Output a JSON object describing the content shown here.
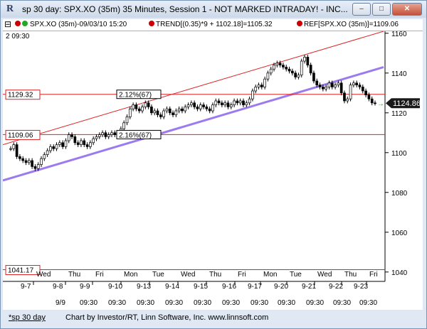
{
  "window": {
    "title": "sp 30 day: SPX.XO (35m) 35 Minutes, Session 1 - NOT MARKED INTRADAY! - INC...",
    "app_icon": "R",
    "minimize_label": "–",
    "maximize_label": "□",
    "close_label": "✕"
  },
  "legend": {
    "symbol": "SPX.XO (35m)-09/03/10 15:20",
    "trend": "TREND[(0.35)*9 + 1102.18]=1105.32",
    "ref": "REF[SPX.XO (35m)]=1109.06",
    "colors": {
      "trend_dot": "#cc0000",
      "ref_dot": "#cc0000",
      "symbol_dot_1": "#cc0000",
      "symbol_dot_2": "#22aa22"
    }
  },
  "chart_header": {
    "start_label": "2  09:30"
  },
  "price_labels": {
    "level1": "1129.32",
    "level2": "1109.06",
    "level3": "1041.17",
    "current": "1124.86",
    "pct1": "2.12%(67)",
    "pct2": "2.16%(67)"
  },
  "chart_data": {
    "type": "candlestick",
    "y_ticks": [
      "1160",
      "1140",
      "1120",
      "1100",
      "1080",
      "1060",
      "1040"
    ],
    "ylim": [
      1036,
      1161
    ],
    "day_labels": [
      "Wed",
      "Thu",
      "Fri",
      "Mon",
      "Tue",
      "Wed",
      "Thu",
      "Fri",
      "Mon",
      "Tue",
      "Wed",
      "Thu",
      "Fri"
    ],
    "date_labels": [
      "9-7",
      "9-8",
      "9-9",
      "9-10",
      "9-13",
      "9-14",
      "9-15",
      "9-16",
      "9-17",
      "9-20",
      "9-21",
      "9-22",
      "9-23"
    ],
    "bottom_labels": [
      "9/9",
      "09:30",
      "09:30",
      "09:30",
      "09:30",
      "09:30",
      "09:30",
      "09:30",
      "09:30",
      "09:30",
      "09:30",
      "09:30"
    ],
    "horizontal_levels": [
      1129.32,
      1109.06,
      1041.17
    ],
    "closes": [
      1102,
      1104,
      1098,
      1097,
      1096,
      1095,
      1096,
      1093,
      1092,
      1094,
      1097,
      1099,
      1101,
      1103,
      1102,
      1104,
      1105,
      1103,
      1106,
      1109,
      1108,
      1105,
      1104,
      1106,
      1104,
      1103,
      1105,
      1107,
      1108,
      1109,
      1110,
      1108,
      1109,
      1110,
      1109,
      1110,
      1112,
      1115,
      1118,
      1122,
      1124,
      1122,
      1121,
      1123,
      1125,
      1123,
      1120,
      1121,
      1119,
      1118,
      1121,
      1122,
      1120,
      1119,
      1121,
      1122,
      1121,
      1123,
      1124,
      1125,
      1123,
      1122,
      1124,
      1123,
      1122,
      1121,
      1124,
      1126,
      1125,
      1124,
      1125,
      1123,
      1124,
      1126,
      1125,
      1126,
      1124,
      1125,
      1127,
      1131,
      1133,
      1134,
      1133,
      1137,
      1140,
      1142,
      1144,
      1145,
      1144,
      1143,
      1142,
      1141,
      1140,
      1138,
      1139,
      1146,
      1148,
      1144,
      1140,
      1136,
      1134,
      1133,
      1132,
      1133,
      1135,
      1133,
      1134,
      1135,
      1130,
      1126,
      1127,
      1134,
      1135,
      1134,
      1133,
      1131,
      1129,
      1127,
      1125,
      1124.86
    ]
  }
}
